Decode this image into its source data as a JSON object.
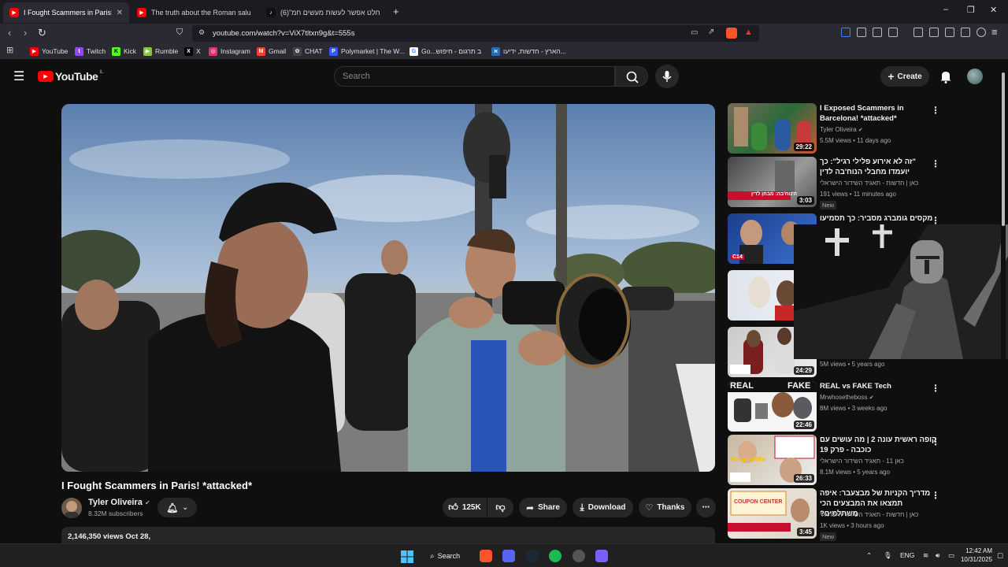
{
  "browser": {
    "tabs": [
      {
        "label": "I Fought Scammers in Paris! *att",
        "icon": "youtube-icon",
        "active": true
      },
      {
        "label": "The truth about the Roman salute #",
        "icon": "youtube-icon",
        "active": false
      },
      {
        "label": "(6)\"בהחלט אפשר לעשות מעשים חמ",
        "icon": "tiktok-icon",
        "active": false
      }
    ],
    "new_tab": "+",
    "window_controls": {
      "minimize": "–",
      "restore": "❐",
      "close": "✕"
    },
    "url": "youtube.com/watch?v=ViX7tltxn9g&t=555s",
    "bookmarks": [
      {
        "label": "YouTube",
        "icon": "youtube-icon",
        "color": "#ff0000"
      },
      {
        "label": "Twitch",
        "icon": "twitch-icon",
        "color": "#9146ff"
      },
      {
        "label": "Kick",
        "icon": "kick-icon",
        "color": "#53fc18"
      },
      {
        "label": "Rumble",
        "icon": "rumble-icon",
        "color": "#85c742"
      },
      {
        "label": "X",
        "icon": "x-icon",
        "color": "#000000"
      },
      {
        "label": "Instagram",
        "icon": "instagram-icon",
        "color": "#e1306c"
      },
      {
        "label": "Gmail",
        "icon": "gmail-icon",
        "color": "#ea4335"
      },
      {
        "label": "CHAT",
        "icon": "chatgpt-icon",
        "color": "#444444"
      },
      {
        "label": "Polymarket | The W...",
        "icon": "polymarket-icon",
        "color": "#2e5cff"
      },
      {
        "label": "Go...ב תרגום - חיפוש",
        "icon": "google-icon",
        "color": "#4285f4"
      },
      {
        "label": "הארץ - חדשות, ידיעו...",
        "icon": "haaretz-icon",
        "color": "#2b6cb0"
      }
    ]
  },
  "youtube": {
    "logo_text": "YouTube",
    "logo_region": "IL",
    "search_placeholder": "Search",
    "create_label": "Create"
  },
  "video": {
    "title": "I Fought Scammers in Paris! *attacked*",
    "channel": "Tyler Oliveira",
    "subscribers": "8.32M subscribers",
    "likes": "125K",
    "share_label": "Share",
    "download_label": "Download",
    "thanks_label": "Thanks",
    "views_date": "2,146,350 views  Oct 28,"
  },
  "recommendations": [
    {
      "title": "I Exposed Scammers in Barcelona! *attacked*",
      "channel": "Tyler Oliveira",
      "meta": "5.5M views • 11 days ago",
      "duration": "29:22",
      "rtl": false,
      "new": ""
    },
    {
      "title": "\"זה לא אירוע פלילי רגיל\": כך יועמדו מחבלי הנוח'בה לדין",
      "channel": "כאן | חדשות - תאגיד השידור הישראלי",
      "meta": "191 views • 11 minutes ago",
      "duration": "3:03",
      "rtl": true,
      "new": "New"
    },
    {
      "title": "מקסים גומברג מסביר: כך תסמיעו",
      "channel": "",
      "meta": "",
      "duration": "",
      "rtl": true,
      "new": ""
    },
    {
      "title": "",
      "channel": "",
      "meta": "",
      "duration": "",
      "rtl": false,
      "new": ""
    },
    {
      "title": "",
      "channel": "",
      "meta": "5M views • 5 years ago",
      "duration": "24:29",
      "rtl": false,
      "new": ""
    },
    {
      "title": "REAL vs FAKE Tech",
      "channel": "Mrwhosetheboss",
      "meta": "8M views • 3 weeks ago",
      "duration": "22:46",
      "rtl": false,
      "new": ""
    },
    {
      "title": "קופה ראשית עונה 2 | מה עושים עם כוכבה - פרק 19",
      "channel": "כאן 11 - תאגיד השידור הישראלי",
      "meta": "8.1M views • 5 years ago",
      "duration": "26:33",
      "rtl": true,
      "new": ""
    },
    {
      "title": "מדריך הקניות של מבצעבר: איפה תמצאו את המבצעים הכי משתלמים?",
      "channel": "כאן | חדשות - תאגיד השידור הישראלי",
      "meta": "1K views • 3 hours ago",
      "duration": "3:45",
      "rtl": true,
      "new": "New"
    }
  ],
  "thumb_text": {
    "r2": "ה'נוח'בה: מבחן לדין",
    "r3": "C14",
    "r6_a": "REAL",
    "r6_b": "FAKE",
    "r7_a": "KingdmWin",
    "r8_a": "COUPON CENTER"
  },
  "taskbar": {
    "search_label": "Search",
    "lang": "ENG",
    "time": "12:42 AM",
    "date": "10/31/2025"
  }
}
